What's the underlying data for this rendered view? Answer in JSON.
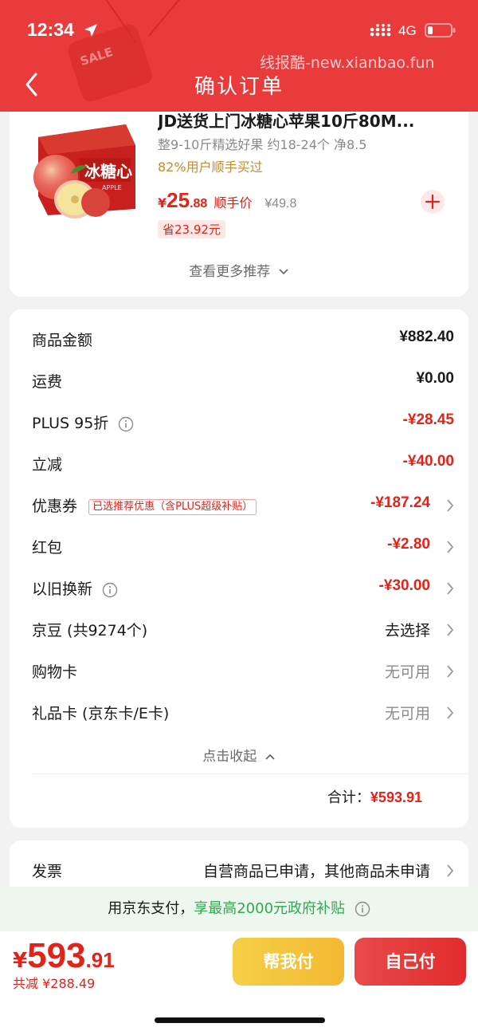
{
  "status_bar": {
    "time": "12:34",
    "network": "4G"
  },
  "header": {
    "title": "确认订单",
    "watermark": "线报酷-new.xianbao.fun",
    "deco_text": "SALE"
  },
  "product": {
    "title": "JD送货上门冰糖心苹果10斤80M...",
    "spec": "整9-10斤精选好果 约18-24个 净8.5",
    "repeat": "82%用户顺手买过",
    "price_symbol": "¥",
    "price_int": "25",
    "price_dec": ".88",
    "price_tag": "顺手价",
    "price_orig": "¥49.8",
    "save": "省23.92元",
    "box_text": "冰糖心",
    "box_sub": "APPLE",
    "more": "查看更多推荐"
  },
  "summary": {
    "rows": [
      {
        "label": "商品金额",
        "value": "¥882.40"
      },
      {
        "label": "运费",
        "value": "¥0.00"
      },
      {
        "label": "PLUS 95折",
        "value": "-¥28.45"
      },
      {
        "label": "立减",
        "value": "-¥40.00"
      },
      {
        "label": "优惠券",
        "tag": "已选推荐优惠（含PLUS超级补贴）",
        "value": "-¥187.24"
      },
      {
        "label": "红包",
        "value": "-¥2.80"
      },
      {
        "label": "以旧换新",
        "value": "-¥30.00"
      },
      {
        "label": "京豆 (共9274个)",
        "value": "去选择"
      },
      {
        "label": "购物卡",
        "value": "无可用"
      },
      {
        "label": "礼品卡 (京东卡/E卡)",
        "value": "无可用"
      }
    ],
    "collapse": "点击收起",
    "total_label": "合计：",
    "total_value": "¥593.91"
  },
  "invoice": {
    "label": "发票",
    "value": "自营商品已申请，其他商品未申请"
  },
  "subsidy": {
    "prefix": "用京东支付，",
    "highlight": "享最高2000元政府补贴"
  },
  "bottom": {
    "pay_symbol": "¥",
    "pay_int": "593",
    "pay_dec": ".91",
    "discount": "共减 ¥288.49",
    "friend_pay": "帮我付",
    "self_pay": "自己付"
  },
  "colors": {
    "brand_red": "#e93b3b",
    "price_red": "#e2231a",
    "friend_button": "#f3c23d",
    "subsidy_green": "#2fa84f"
  }
}
